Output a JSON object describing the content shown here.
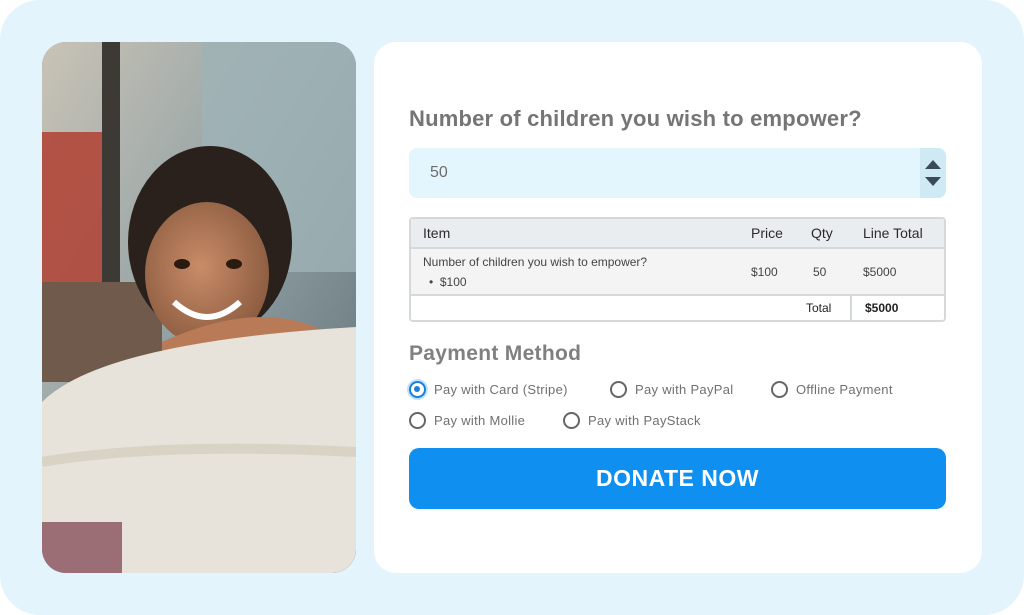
{
  "form": {
    "question": "Number of children you wish to empower?",
    "quantity_value": "50"
  },
  "table": {
    "headers": [
      "Item",
      "Price",
      "Qty",
      "Line Total"
    ],
    "row": {
      "item": "Number of children you wish to empower?",
      "option": "$100",
      "price": "$100",
      "qty": "50",
      "line_total": "$5000"
    },
    "total_label": "Total",
    "total_value": "$5000"
  },
  "payment": {
    "heading": "Payment Method",
    "options": [
      {
        "label": "Pay with Card (Stripe)",
        "selected": true
      },
      {
        "label": "Pay with PayPal",
        "selected": false
      },
      {
        "label": "Offline Payment",
        "selected": false
      },
      {
        "label": "Pay with Mollie",
        "selected": false
      },
      {
        "label": "Pay with PayStack",
        "selected": false
      }
    ]
  },
  "donate_label": "DONATE NOW",
  "colors": {
    "background": "#e3f4fd",
    "accent": "#0f8ff0",
    "radio_selected": "#1c7fd6"
  },
  "icons": [
    "stepper-up-icon",
    "stepper-down-icon",
    "bullet-icon"
  ]
}
